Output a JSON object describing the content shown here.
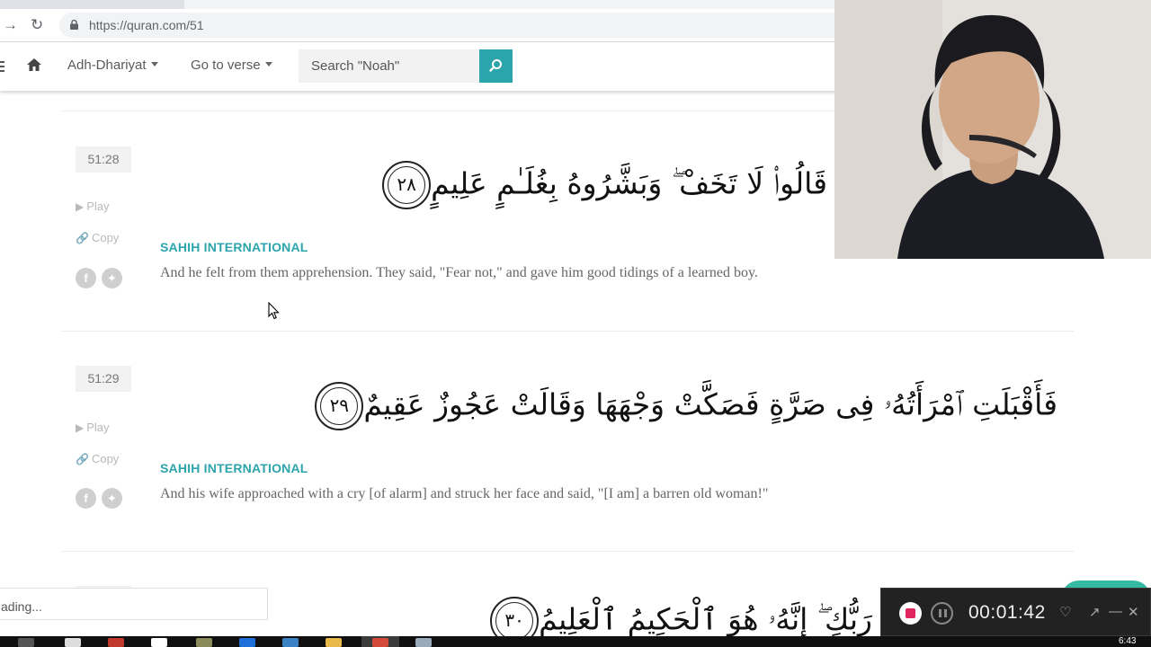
{
  "browser": {
    "url": "https://quran.com/51"
  },
  "navbar": {
    "surah_label": "Adh-Dhariyat",
    "goto_label": "Go to verse",
    "search_placeholder": "Search \"Noah\""
  },
  "verses": [
    {
      "key": "51:28",
      "arabic": "قَالُوا۟ لَا تَخَفْ ۖ وَبَشَّرُوهُ بِغُلَـٰمٍ عَلِيمٍ",
      "number": "٢٨",
      "play_label": "Play",
      "copy_label": "Copy",
      "translator": "SAHIH INTERNATIONAL",
      "translation": "And he felt from them apprehension. They said, \"Fear not,\" and gave him good tidings of a learned boy."
    },
    {
      "key": "51:29",
      "arabic": "فَأَقْبَلَتِ ٱمْرَأَتُهُۥ فِى صَرَّةٍ فَصَكَّتْ وَجْهَهَا وَقَالَتْ عَجُوزٌ عَقِيمٌ",
      "number": "٢٩",
      "play_label": "Play",
      "copy_label": "Copy",
      "translator": "SAHIH INTERNATIONAL",
      "translation": "And his wife approached with a cry [of alarm] and struck her face and said, \"[I am] a barren old woman!\""
    },
    {
      "arabic": "رَبُّكِ ۖ إِنَّهُۥ هُوَ ٱلْحَكِيمُ ٱلْعَلِيمُ",
      "number": "٣٠"
    }
  ],
  "status": {
    "loading_text": "ading..."
  },
  "recorder": {
    "time": "00:01:42"
  },
  "taskbar": {
    "clock": "6:43 PM"
  },
  "colors": {
    "accent": "#2ca4ab",
    "record": "#e0245e"
  }
}
